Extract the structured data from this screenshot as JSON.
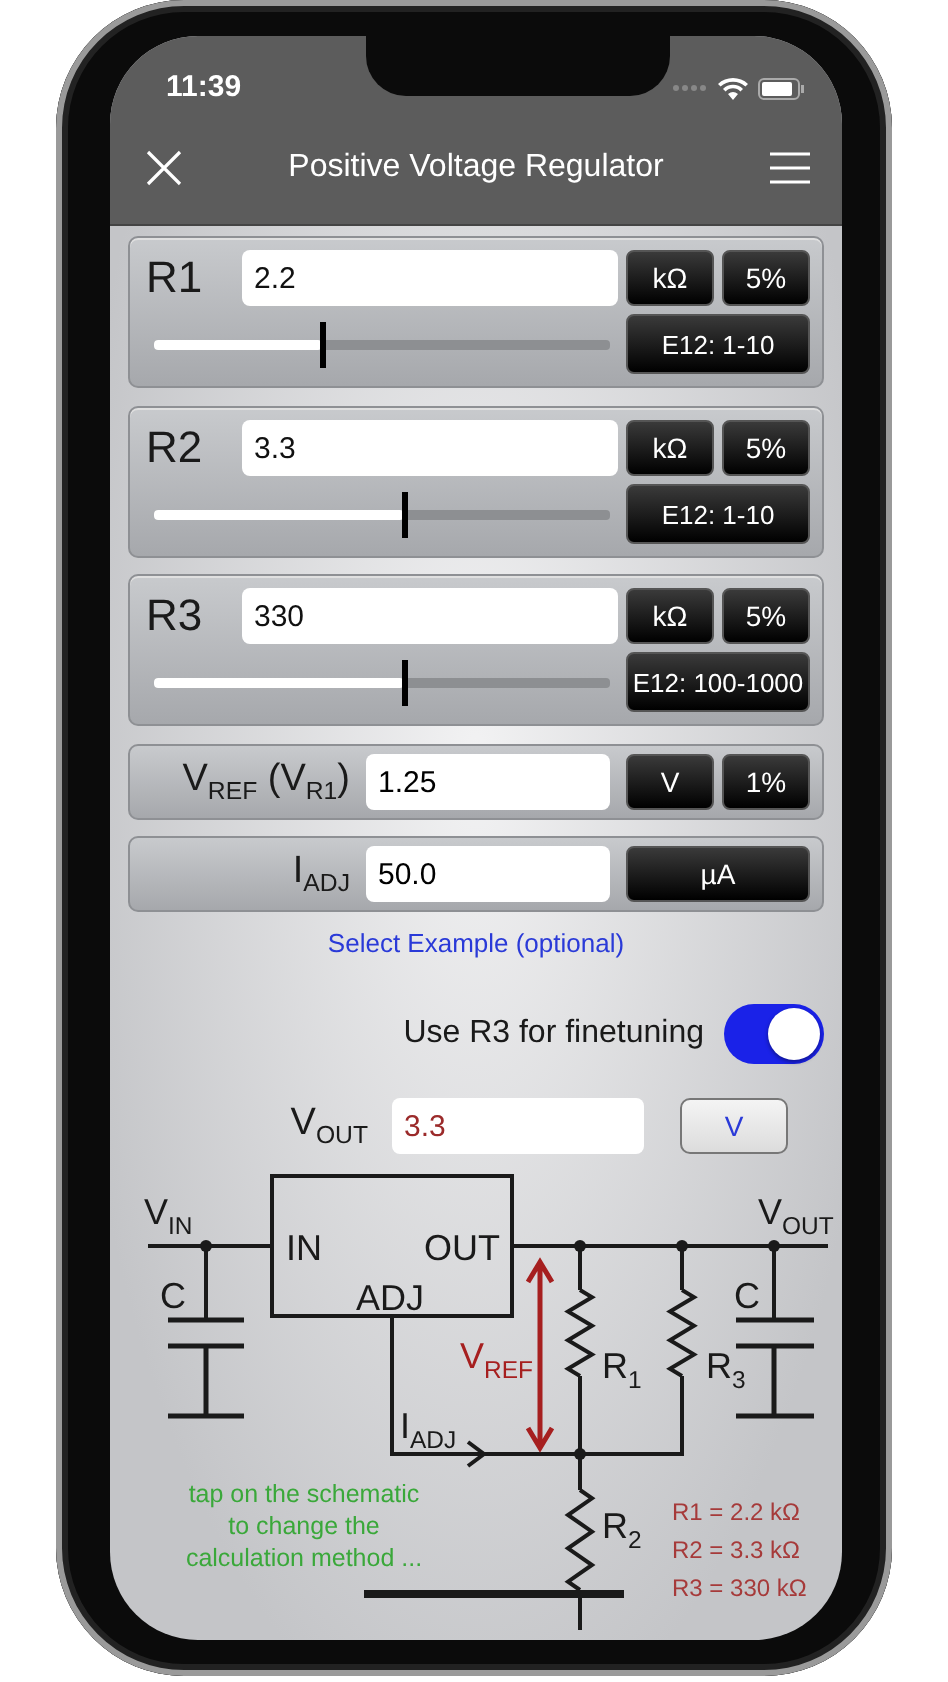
{
  "status_bar": {
    "time": "11:39"
  },
  "nav": {
    "title": "Positive Voltage Regulator"
  },
  "resistors": [
    {
      "label": "R1",
      "value": "2.2",
      "unit": "kΩ",
      "tolerance": "5%",
      "series": "E12: 1-10",
      "level": 0.37
    },
    {
      "label": "R2",
      "value": "3.3",
      "unit": "kΩ",
      "tolerance": "5%",
      "series": "E12: 1-10",
      "level": 0.55
    },
    {
      "label": "R3",
      "value": "330",
      "unit": "kΩ",
      "tolerance": "5%",
      "series": "E12: 100-1000",
      "level": 0.55
    }
  ],
  "inputs": [
    {
      "label": "V$_{REF}$ (V$_{R1}$)",
      "value": "1.25",
      "buttons": [
        "V",
        "1%"
      ]
    },
    {
      "label": "I$_{ADJ}$",
      "value": "50.0",
      "buttons": [
        "µA"
      ]
    }
  ],
  "example_link": "Select Example (optional)",
  "toggle": {
    "label": "Use R3 for finetuning",
    "on": true
  },
  "output": {
    "label": "V$_{OUT}$",
    "value": "3.3",
    "unit": "V"
  },
  "schematic": {
    "labels": [
      "V$_{IN}$",
      "C",
      "IN",
      "OUT",
      "ADJ",
      "V$_{REF}$",
      "R$_{1}$",
      "R$_{3}$",
      "I$_{ADJ}$",
      "R$_{2}$",
      "C",
      "V$_{OUT}$"
    ],
    "hint": "tap on the schematic to change the calculation method ...",
    "results": [
      "R1 = 2.2 kΩ",
      "R2 = 3.3 kΩ",
      "R3 = 330 kΩ"
    ]
  }
}
